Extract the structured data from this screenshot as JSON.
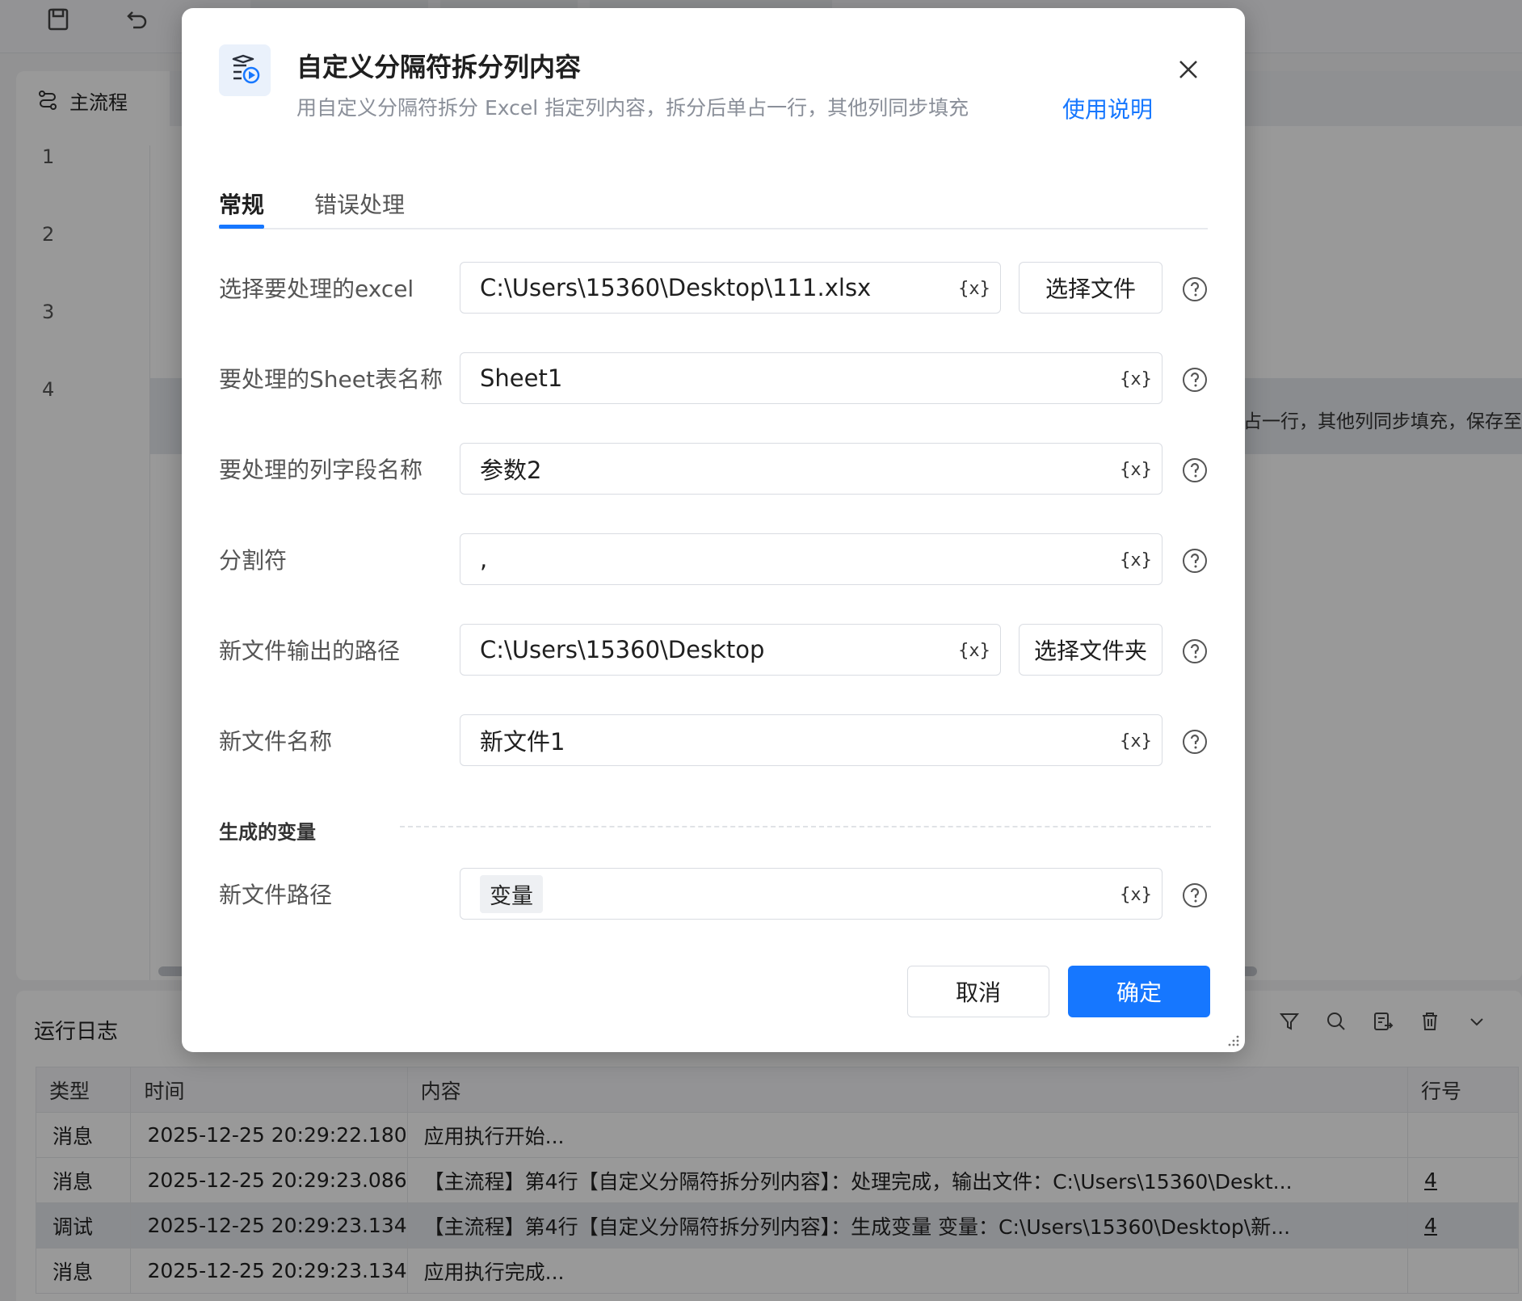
{
  "editor": {
    "process_title": "主流程",
    "line_numbers": [
      "1",
      "2",
      "3",
      "4"
    ],
    "row4_text": "占一行，其他列同步填充，保存至"
  },
  "log": {
    "title": "运行日志",
    "columns": [
      "类型",
      "时间",
      "内容",
      "行号"
    ],
    "rows": [
      {
        "type": "消息",
        "time": "2025-12-25 20:29:22.180",
        "content": "应用执行开始...",
        "line": ""
      },
      {
        "type": "消息",
        "time": "2025-12-25 20:29:23.086",
        "content": "【主流程】第4行【自定义分隔符拆分列内容】：处理完成，输出文件：C:\\Users\\15360\\Deskt...",
        "line": "4"
      },
      {
        "type": "调试",
        "time": "2025-12-25 20:29:23.134",
        "content": "【主流程】第4行【自定义分隔符拆分列内容】：生成变量 变量：C:\\Users\\15360\\Desktop\\新...",
        "line": "4"
      },
      {
        "type": "消息",
        "time": "2025-12-25 20:29:23.134",
        "content": "应用执行完成...",
        "line": ""
      }
    ]
  },
  "dialog": {
    "title": "自定义分隔符拆分列内容",
    "subtitle": "用自定义分隔符拆分 Excel 指定列内容，拆分后单占一行，其他列同步填充",
    "help_link": "使用说明",
    "tabs": [
      "常规",
      "错误处理"
    ],
    "var_icon_text": "{x}",
    "fields": {
      "excel": {
        "label": "选择要处理的excel",
        "value": "C:\\Users\\15360\\Desktop\\111.xlsx",
        "button": "选择文件"
      },
      "sheet": {
        "label": "要处理的Sheet表名称",
        "value": "Sheet1"
      },
      "column": {
        "label": "要处理的列字段名称",
        "value": "参数2"
      },
      "delimiter": {
        "label": "分割符",
        "value": ","
      },
      "output_path": {
        "label": "新文件输出的路径",
        "value": "C:\\Users\\15360\\Desktop",
        "button": "选择文件夹"
      },
      "file_name": {
        "label": "新文件名称",
        "value": "新文件1"
      }
    },
    "output_section": "生成的变量",
    "output_var": {
      "label": "新文件路径",
      "value": "变量"
    },
    "cancel": "取消",
    "ok": "确定"
  },
  "colors": {
    "primary": "#1677ff"
  }
}
